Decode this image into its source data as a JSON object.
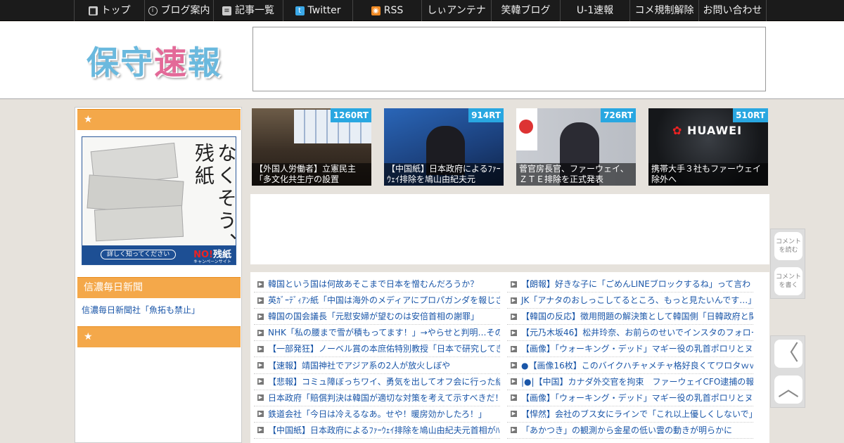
{
  "nav": {
    "items": [
      {
        "label": "トップ",
        "icon": "home-icon",
        "glyph": "▆"
      },
      {
        "label": "ブログ案内",
        "icon": "info-icon",
        "glyph": "i"
      },
      {
        "label": "記事一覧",
        "icon": "list-icon",
        "glyph": "≡"
      },
      {
        "label": "Twitter",
        "icon": "twitter-icon",
        "glyph": "t"
      },
      {
        "label": "RSS",
        "icon": "rss-icon",
        "glyph": "◉"
      },
      {
        "label": "しぃアンテナ"
      },
      {
        "label": "笑韓ブログ"
      },
      {
        "label": "U-1速報"
      },
      {
        "label": "コメ規制解除"
      },
      {
        "label": "お問い合わせ"
      }
    ]
  },
  "header": {
    "logo_a": "保守",
    "logo_b": "速",
    "logo_c": "報"
  },
  "sidebar": {
    "head1": "★",
    "banner": {
      "text": "なくそう、残紙",
      "button": "詳しく知ってください",
      "no_mark": "NO!",
      "no_text": "残紙",
      "sub": "キャンペーンサイト"
    },
    "head2": "信濃毎日新聞",
    "link": "信濃毎日新聞社「魚拓も禁止」",
    "head3": "★"
  },
  "featured": [
    {
      "rt": "1260RT",
      "caption": "【外国人労働者】立憲民主「多文化共生庁の設置"
    },
    {
      "rt": "914RT",
      "caption": "【中国紙】日本政府によるﾌｧｰｳｪｲ排除を鳩山由紀夫元"
    },
    {
      "rt": "726RT",
      "caption": "菅官房長官、ファーウェイ、ＺＴＥ排除を正式発表"
    },
    {
      "rt": "510RT",
      "caption": "携帯大手３社もファーウェイ除外へ"
    }
  ],
  "headlines": {
    "left": [
      "韓国という国は何故あそこまで日本を憎むんだろうか？",
      "英ｶﾞｰﾃﾞｨｱﾝ紙「中国は海外のメディアにプロパガンダを報じさ",
      "韓国の国会議長「元慰安婦が望むのは安倍首相の謝罪」",
      "NHK「私の腰まで雪が積もってます！」→やらせと判明…その",
      "【一部発狂】ノーベル賞の本庶佑特別教授「日本で研究してき",
      "【速報】靖国神社でアジア系の2人が放火しぼや",
      "【悲報】コミュ障ぼっちワイ、勇気を出してオフ会に行った結",
      "日本政府「賠償判決は韓国が適切な対策を考えて示すべきだ！",
      "鉄道会社「今日は冷えるなあ。せや！暖房効かしたろ！」",
      "【中国紙】日本政府によるﾌｧｰｳｪｲ排除を鳩山由紀夫元首相がﾊﾟ"
    ],
    "right": [
      "【朗報】好きな子に「ごめんLINEブロックするね」って言わ",
      "JK「アナタのおしっこしてるところ、もっと見たいんです…」",
      "【韓国の反応】徴用問題の解決策として韓国側「日韓政府と関",
      "【元乃木坂46】松井玲奈、お前らのせいでインスタのフォロー",
      "【画像】「ウォーキング・デッド」マギー役の乳首ポロリとヌ",
      "●【画像16枚】このバイクハチャメチャ格好良くてワロタｗｗｗ",
      "|●|【中国】カナダ外交官を拘束　ファーウェイCFO逮捕の報",
      "【画像】「ウォーキング・デッド」マギー役の乳首ポロリとヌ",
      "【悍然】会社のブス女にラインで「これ以上優しくしないで」",
      "「あかつき」の観測から金星の低い雲の動きが明らかに"
    ]
  },
  "side_buttons": {
    "read_comments": "コメントを読む",
    "write_comment": "コメントを書く",
    "back_glyph": "〈",
    "top_glyph": "︿"
  }
}
